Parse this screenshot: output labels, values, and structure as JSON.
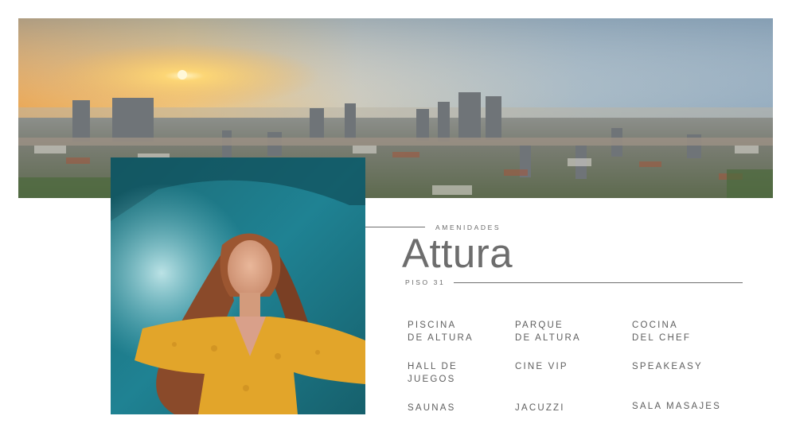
{
  "hero": {
    "image": "city-skyline-panorama-at-sunset"
  },
  "portrait": {
    "image": "woman-floating-in-pool-yellow-blouse"
  },
  "heading": {
    "eyebrow": "AMENIDADES",
    "title": "Attura",
    "floor": "PISO 31"
  },
  "amenities": [
    "PISCINA\nDE ALTURA",
    "PARQUE\nDE ALTURA",
    "COCINA\nDEL CHEF",
    "HALL DE\nJUEGOS",
    "CINE VIP",
    "SPEAKEASY",
    "SAUNAS",
    "JACUZZI",
    "SALA MASAJES"
  ],
  "colors": {
    "text": "#5e5e5e",
    "title": "#6d6d6d",
    "rule": "#6f6f6f",
    "background": "#ffffff"
  }
}
